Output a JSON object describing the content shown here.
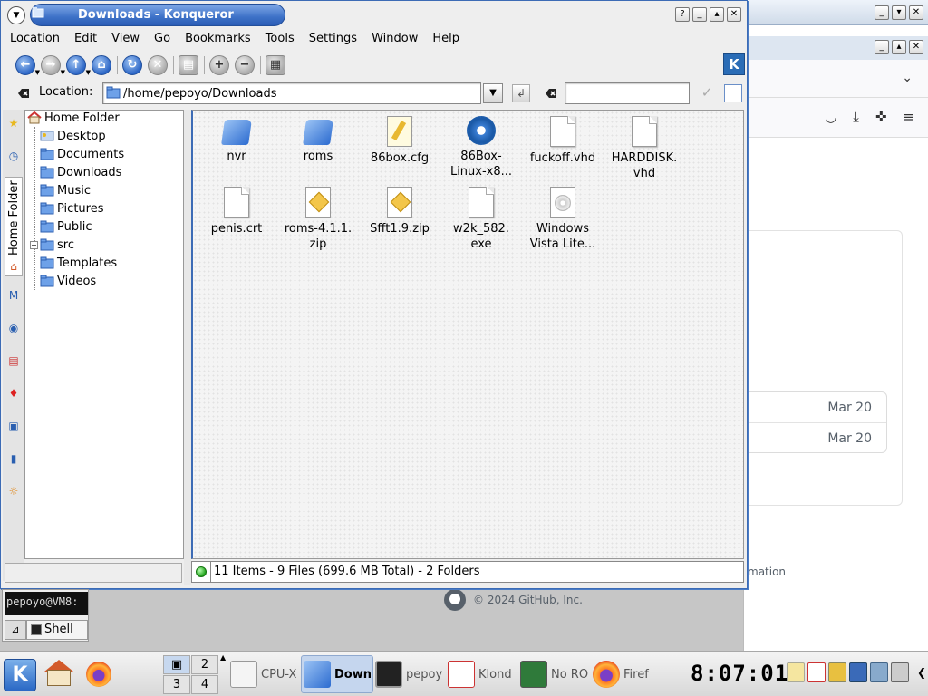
{
  "konqueror": {
    "title": "Downloads - Konqueror",
    "menu": [
      "Location",
      "Edit",
      "View",
      "Go",
      "Bookmarks",
      "Tools",
      "Settings",
      "Window",
      "Help"
    ],
    "location_label": "Location:",
    "location_value": "/home/pepoyo/Downloads",
    "find_value": ""
  },
  "tree": {
    "root": "Home Folder",
    "items": [
      "Desktop",
      "Documents",
      "Downloads",
      "Music",
      "Pictures",
      "Public",
      "src",
      "Templates",
      "Videos"
    ]
  },
  "nav_tab_label": "Home Folder",
  "files": [
    {
      "name": "nvr",
      "type": "folder"
    },
    {
      "name": "roms",
      "type": "folder"
    },
    {
      "name": "86box.cfg",
      "type": "cfg"
    },
    {
      "name": "86Box-\nLinux-x8...",
      "type": "gear"
    },
    {
      "name": "fuckoff.vhd",
      "type": "doc"
    },
    {
      "name": "HARDDISK.\nvhd",
      "type": "doc"
    },
    {
      "name": "penis.crt",
      "type": "doc"
    },
    {
      "name": "roms-4.1.1.\nzip",
      "type": "zip"
    },
    {
      "name": "Sfft1.9.zip",
      "type": "zip"
    },
    {
      "name": "w2k_582.\nexe",
      "type": "doc"
    },
    {
      "name": "Windows\nVista Lite...",
      "type": "disc"
    }
  ],
  "status": "11 Items - 9 Files (699.6 MB Total) - 2 Folders",
  "shell": {
    "prompt": "pepoyo@VM8:",
    "tab_label": "Shell"
  },
  "background": {
    "rows": [
      "Mar 20",
      "Mar 20"
    ],
    "info_fragment": "mation",
    "footer": "© 2024 GitHub, Inc."
  },
  "taskbar": {
    "pager": [
      "2",
      "3",
      "4"
    ],
    "tasks": [
      "CPU-X",
      "Down",
      "pepoy",
      "Klond",
      "No RO",
      "Firef"
    ],
    "clock": "8:07:01"
  }
}
